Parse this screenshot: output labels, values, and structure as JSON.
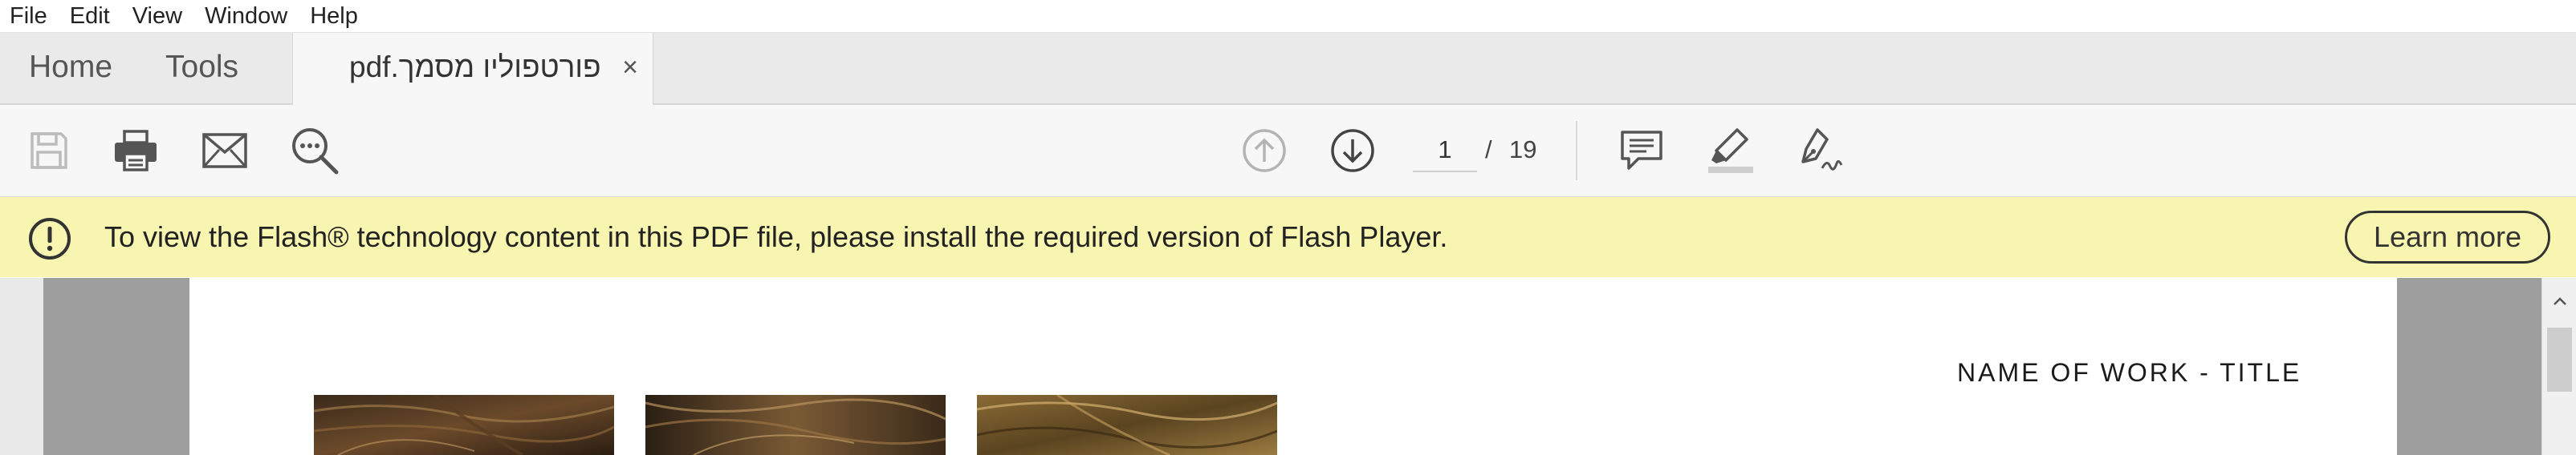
{
  "menubar": {
    "items": [
      "File",
      "Edit",
      "View",
      "Window",
      "Help"
    ]
  },
  "tabs": {
    "home_label": "Home",
    "tools_label": "Tools",
    "document_title": "פורטפוליו מסמך.pdf",
    "close_glyph": "×"
  },
  "toolbar": {
    "buttons": [
      "save-icon",
      "print-icon",
      "email-icon",
      "search-more-icon",
      "prev-page-icon",
      "next-page-icon",
      "comment-icon",
      "highlight-icon",
      "sign-icon"
    ],
    "current_page": "1",
    "page_separator": "/",
    "total_pages": "19"
  },
  "notification": {
    "icon": "exclamation-circle-icon",
    "message": "To view the Flash® technology content in this PDF file, please install the required version of Flash Player.",
    "button_label": "Learn more",
    "background": "#f8f5b0"
  },
  "document": {
    "work_title": "NAME OF WORK - TITLE",
    "images": [
      "hair-photo-1",
      "hair-photo-2",
      "hair-photo-3"
    ]
  }
}
